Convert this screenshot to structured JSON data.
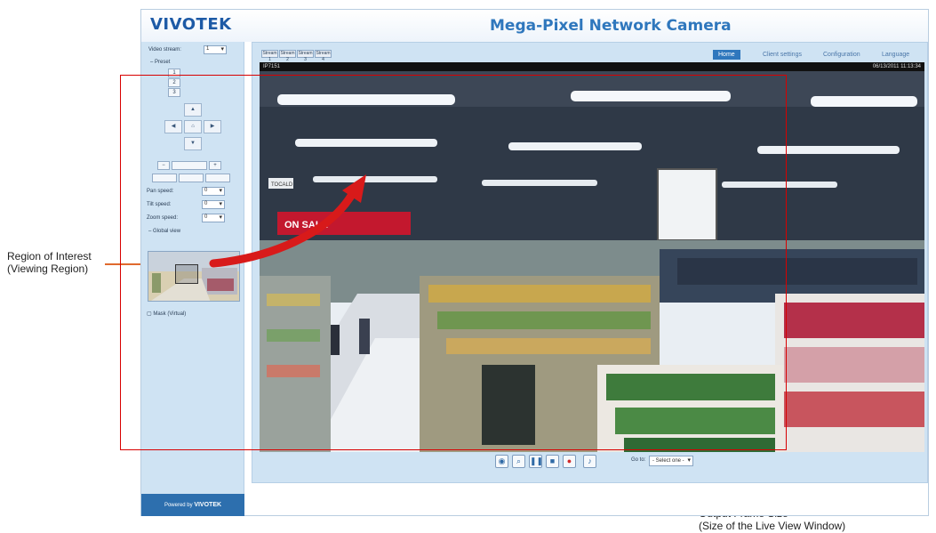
{
  "annotations": {
    "roi_line1": "Region of Interest",
    "roi_line2": "(Viewing Region)",
    "ofs_line1": "Output Frame Size",
    "ofs_line2": "(Size of the Live View Window)"
  },
  "header": {
    "logo": "VIVOTEK",
    "title": "Mega-Pixel Network Camera"
  },
  "sidebar": {
    "video_stream_label": "Video stream:",
    "video_stream_value": "1",
    "preset_label": "Preset",
    "pan_speed_label": "Pan speed:",
    "pan_speed_value": "0",
    "tilt_speed_label": "Tilt speed:",
    "tilt_speed_value": "0",
    "zoom_speed_label": "Zoom speed:",
    "zoom_speed_value": "0",
    "global_view_label": "Global view",
    "mask_label": "Mask (Virtual)",
    "footer_text": "Powered by",
    "footer_brand": "VIVOTEK"
  },
  "main": {
    "stream_tabs": [
      "Stream 1",
      "Stream 2",
      "Stream 3",
      "Stream 4"
    ],
    "nav": {
      "home": "Home",
      "client_settings": "Client settings",
      "configuration": "Configuration",
      "language": "Language"
    },
    "video_bar_left": "IP7151",
    "video_bar_right": "06/13/2011 11:13:34",
    "video_label": "TOCALD",
    "sign_text": "ON SALE",
    "goto_label": "Go to:",
    "goto_value": "- Select one -"
  },
  "colors": {
    "accent": "#2f77bd",
    "sidebar_bg": "#cfe3f3",
    "roi_border": "#d80000",
    "callout_line": "#e06a2e",
    "arrow": "#d81a1a"
  },
  "icons": [
    "snapshot-icon",
    "digital-zoom-icon",
    "pause-icon",
    "stop-icon",
    "record-icon",
    "volume-icon"
  ]
}
